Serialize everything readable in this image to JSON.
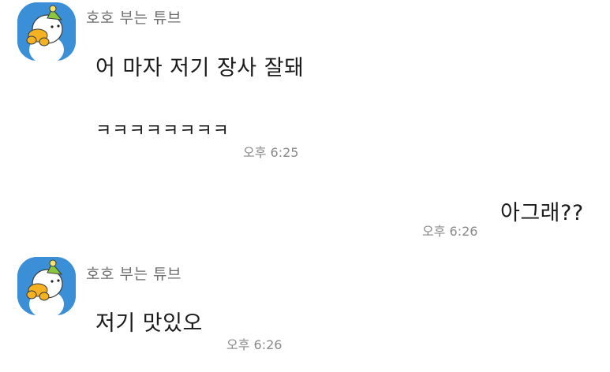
{
  "chat": {
    "groups": [
      {
        "sender": "호호 부는 튜브",
        "avatar_icon": "tube-duck-avatar-icon",
        "messages": [
          {
            "text": "어 마자 저기 장사 잘돼"
          },
          {
            "text": "ㅋㅋㅋㅋㅋㅋㅋㅋ"
          }
        ],
        "time": "오후 6:25"
      },
      {
        "mine": true,
        "messages": [
          {
            "text": "아그래??"
          }
        ],
        "time": "오후 6:26"
      },
      {
        "sender": "호호 부는 튜브",
        "avatar_icon": "tube-duck-avatar-icon",
        "messages": [
          {
            "text": "저기 맛있오"
          }
        ],
        "time": "오후 6:26"
      }
    ]
  },
  "colors": {
    "avatar_bg": "#3a8fd6",
    "duck_yellow": "#f4b223",
    "hat_green": "#8cc63f",
    "sender_text": "#6e6e6e",
    "time_text": "#8a8a8a"
  }
}
